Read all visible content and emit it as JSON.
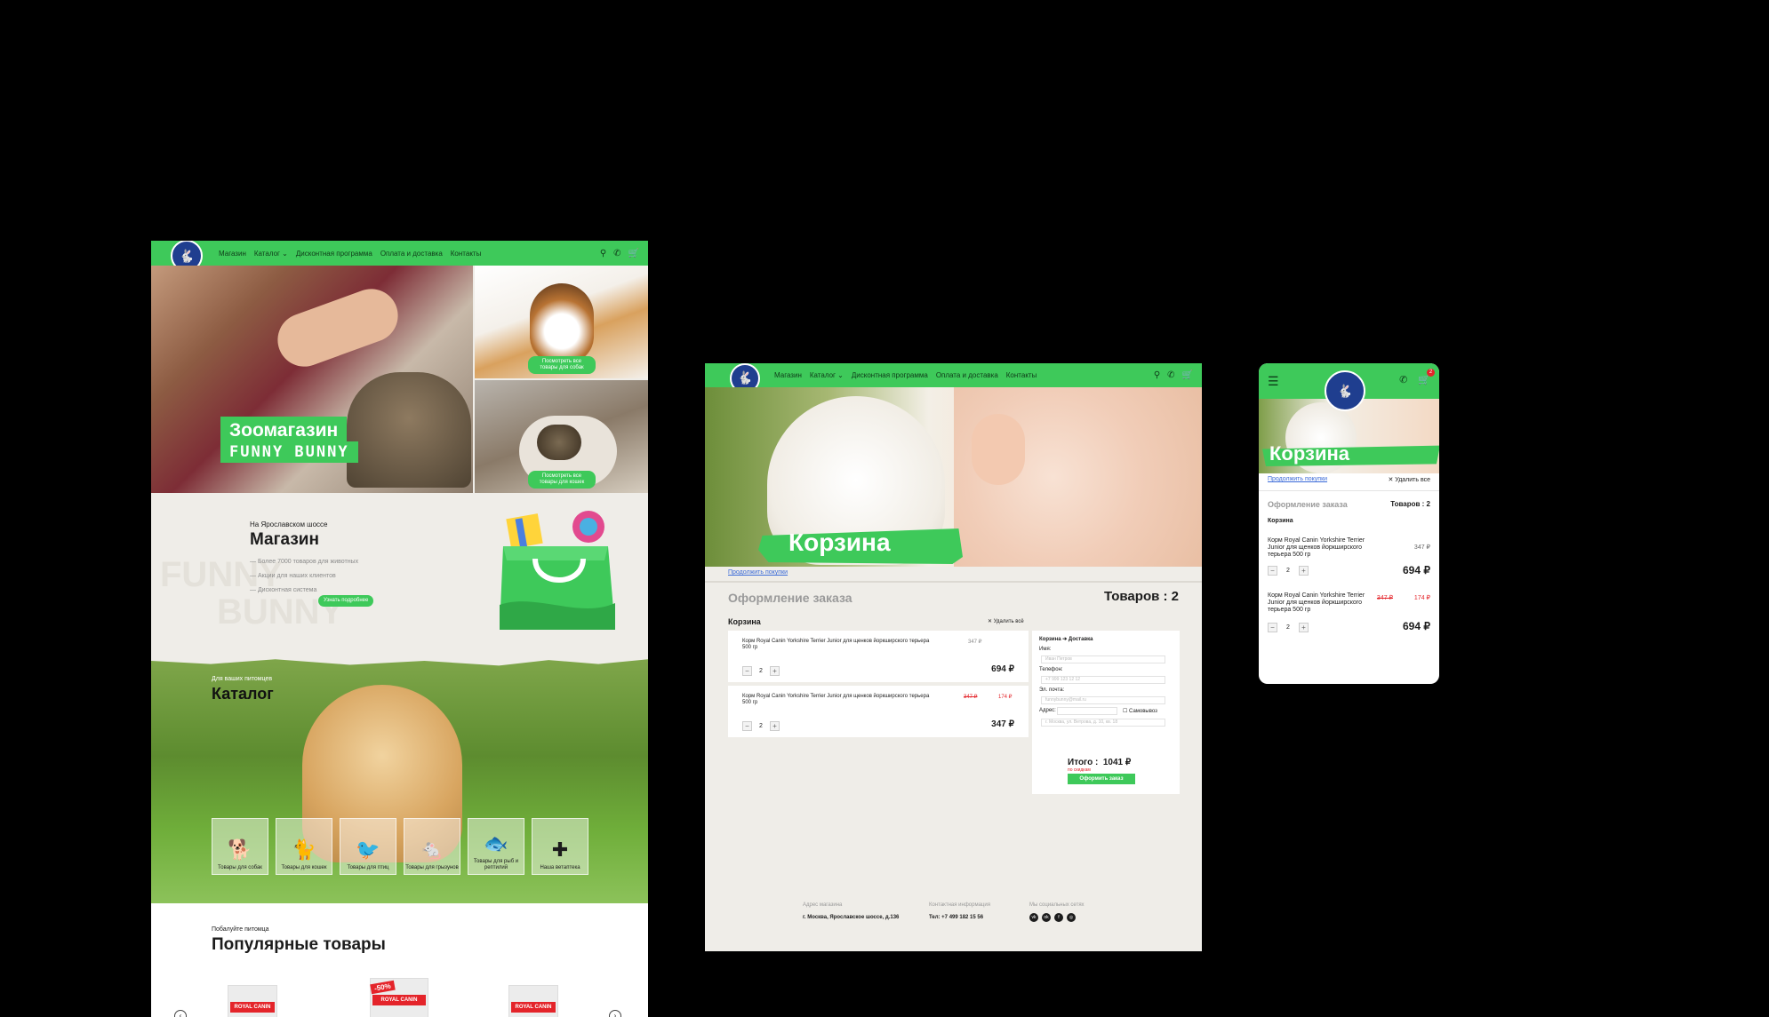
{
  "nav": {
    "items": [
      "Магазин",
      "Каталог ⌄",
      "Дисконтная программа",
      "Оплата и доставка",
      "Контакты"
    ],
    "icons": [
      "search-icon",
      "phone-icon",
      "cart-icon"
    ],
    "accent_color": "#3ec95a"
  },
  "home": {
    "hero": {
      "title_1": "Зоомагазин",
      "title_2": "FUNNY BUNNY",
      "dogs_button": "Посмотреть все товары для собак",
      "cats_button": "Посмотреть все товары для кошек"
    },
    "shop": {
      "subtitle": "На Ярославском шоссе",
      "title": "Магазин",
      "bullets": [
        "— Более 7000 товаров для животных",
        "— Акции для наших клиентов",
        "— Дисконтная система"
      ],
      "button": "Узнать подробнее",
      "bg_text_1": "FUNNY",
      "bg_text_2": "BUNNY"
    },
    "catalog": {
      "subtitle": "Для ваших питомцев",
      "title": "Каталог",
      "tiles": [
        {
          "icon": "dog-icon",
          "label": "Товары для собак"
        },
        {
          "icon": "cat-icon",
          "label": "Товары для кошек"
        },
        {
          "icon": "bird-icon",
          "label": "Товары для птиц"
        },
        {
          "icon": "rodent-icon",
          "label": "Товары для грызунов"
        },
        {
          "icon": "fish-icon",
          "label": "Товары для рыб и рептилий"
        },
        {
          "icon": "vet-icon",
          "label": "Наша ветаптека"
        }
      ]
    },
    "popular": {
      "subtitle": "Побалуйте питомца",
      "title": "Популярные товары",
      "brand": "ROYAL CANIN",
      "sale_badge": "-50%"
    }
  },
  "cart": {
    "title": "Корзина",
    "continue_link": "Продолжить покупки",
    "order_title": "Оформление заказа",
    "goods_count": "Товаров : 2",
    "cart_label": "Корзина",
    "delete_all": "✕ Удалить всё",
    "items": [
      {
        "name": "Корм Royal Canin Yorkshire Terrier Junior для щенков йоркширского терьера 500 гр",
        "price_old": "347 ₽",
        "price_new": "",
        "qty": "2",
        "total": "694 ₽"
      },
      {
        "name": "Корм Royal Canin Yorkshire Terrier Junior для щенков йоркширского терьера 500 гр",
        "price_old": "347 ₽",
        "price_new": "174 ₽",
        "qty": "2",
        "total": "347 ₽"
      }
    ],
    "form": {
      "steps": "Корзина  ➔  Доставка",
      "name_label": "Имя:",
      "name_placeholder": "Иван Петров",
      "phone_label": "Телефон:",
      "phone_placeholder": "+7 999 123 12 12",
      "email_label": "Эл. почта:",
      "email_placeholder": "funnybunny@mail.ru",
      "address_label": "Адрес:",
      "pickup_label": "Самовывоз",
      "address_placeholder": "г. Москва, ул. Ветрова, д. 10, кв. 18",
      "total_label": "Итого :",
      "total_value": "1041 ₽",
      "total_note": "по скидкам",
      "order_button": "Оформить заказ"
    },
    "footer": {
      "address_head": "Адрес магазина",
      "address": "г. Москва, Ярославское шоссе, д.136",
      "contact_head": "Контактная информация",
      "phone": "Тел: +7 499 182 15 56",
      "social_head": "Мы социальных сетях",
      "socials": [
        "vk",
        "ok",
        "fb",
        "ig"
      ]
    }
  },
  "mobile": {
    "title": "Корзина",
    "continue_link": "Продолжить покупки",
    "delete_all": "✕ Удалить все",
    "order_title": "Оформление заказа",
    "goods_count": "Товаров : 2",
    "cart_label": "Корзина",
    "cart_badge": "2",
    "items": [
      {
        "name": "Корм Royal Canin Yorkshire Terrier Junior для щенков йоркширского терьера 500 гр",
        "price_old": "347 ₽",
        "price_new": "",
        "qty": "2",
        "total": "694 ₽"
      },
      {
        "name": "Корм Royal Canin Yorkshire Terrier Junior для щенков йоркширского терьера 500 гр",
        "price_old": "347 ₽",
        "price_new": "174 ₽",
        "qty": "2",
        "total": "694 ₽"
      }
    ]
  }
}
